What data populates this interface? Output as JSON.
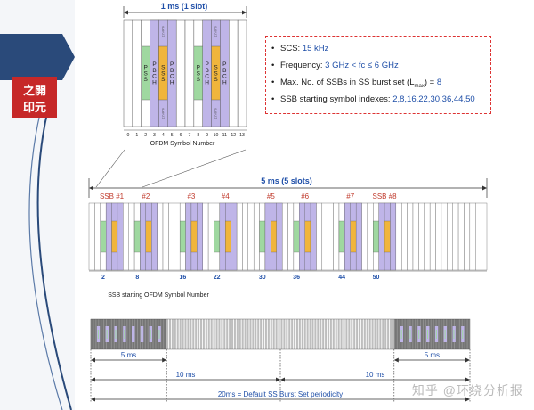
{
  "top_slot": {
    "duration_label": "1 ms (1 slot)",
    "symbol_numbers": [
      "0",
      "1",
      "2",
      "3",
      "4",
      "5",
      "6",
      "7",
      "8",
      "9",
      "10",
      "11",
      "12",
      "13"
    ],
    "axis_title": "OFDM Symbol Number",
    "channel_labels": {
      "pss": "PSS",
      "pbch": "PBCH",
      "sss": "SSS",
      "pbch_small": "PBCH"
    }
  },
  "info": {
    "scs_label": "SCS:",
    "scs_value": "15 kHz",
    "freq_label": "Frequency:",
    "freq_value": "3 GHz < fc ≤ 6 GHz",
    "lmax_label": "Max. No. of SSBs in SS burst set (L",
    "lmax_sub": "max",
    "lmax_tail": ") =",
    "lmax_value": "8",
    "start_label": "SSB starting symbol indexes:",
    "start_value": "2,8,16,22,30,36,44,50"
  },
  "middle": {
    "duration_label": "5 ms (5 slots)",
    "ssb_labels": [
      "SSB #1",
      "#2",
      "#3",
      "#4",
      "#5",
      "#6",
      "#7",
      "SSB #8"
    ],
    "start_symbols": [
      "2",
      "8",
      "16",
      "22",
      "30",
      "36",
      "44",
      "50"
    ],
    "axis_title": "SSB starting OFDM Symbol Number"
  },
  "bottom": {
    "five_ms_left": "5 ms",
    "five_ms_right": "5 ms",
    "ten_ms_left": "10 ms",
    "ten_ms_right": "10 ms",
    "periodicity": "20ms = Default SS Burst Set periodicity"
  },
  "logo": {
    "text": "之開印元"
  },
  "watermark": "知乎 @环绕分析报",
  "colors": {
    "pss": "#9fd8a0",
    "sss": "#f0b53c",
    "pbch": "#bfb5e8",
    "accent_blue": "#1f4fa8",
    "label_red": "#c0392b",
    "sidebar": "#2a4a7a"
  }
}
